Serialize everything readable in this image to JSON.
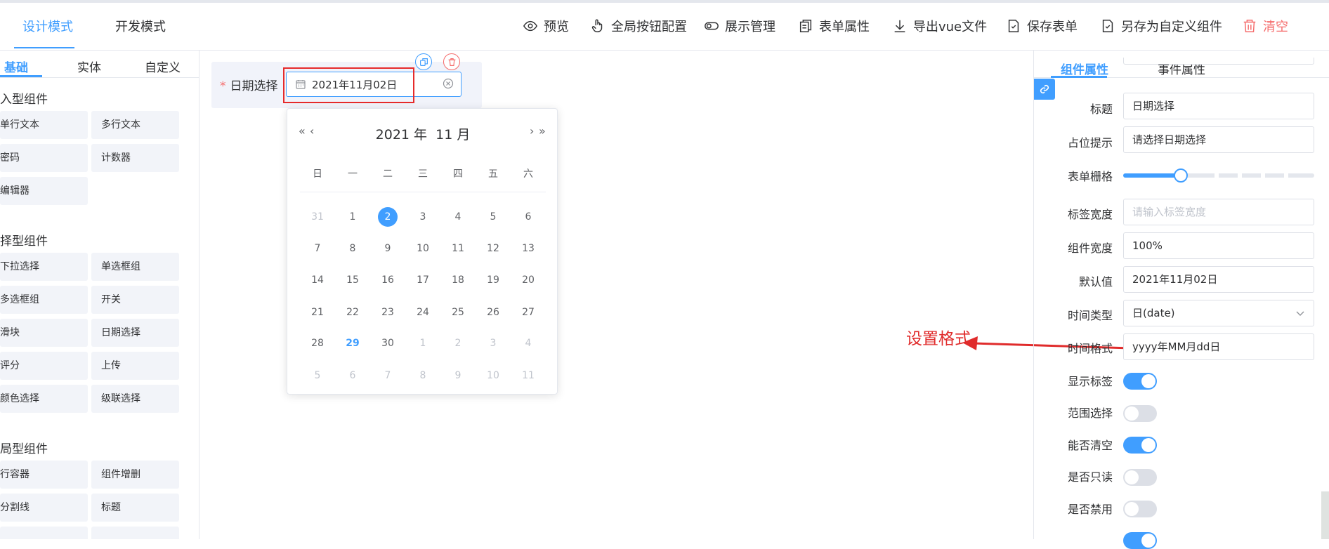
{
  "topbar": {
    "mode_tabs": [
      "设计模式",
      "开发模式"
    ],
    "actions": {
      "preview": "预览",
      "global_buttons": "全局按钮配置",
      "display": "展示管理",
      "form_props": "表单属性",
      "export_vue": "导出vue文件",
      "save_form": "保存表单",
      "save_as_custom": "另存为自定义组件",
      "clear": "清空"
    }
  },
  "left": {
    "tabs": [
      "基础",
      "实体",
      "自定义"
    ],
    "groups": [
      {
        "title": "入型组件",
        "items": [
          "单行文本",
          "多行文本",
          "密码",
          "计数器",
          "编辑器"
        ]
      },
      {
        "title": "择型组件",
        "items": [
          "下拉选择",
          "单选框组",
          "多选框组",
          "开关",
          "滑块",
          "日期选择",
          "评分",
          "上传",
          "颜色选择",
          "级联选择"
        ]
      },
      {
        "title": "局型组件",
        "items": [
          "行容器",
          "组件增删",
          "分割线",
          "标题"
        ]
      }
    ]
  },
  "canvas": {
    "field_label": "日期选择",
    "field_value": "2021年11月02日"
  },
  "picker": {
    "year_label": "2021 年",
    "month_label": "11 月",
    "nav_prev_year": "«",
    "nav_prev_month": "‹",
    "nav_next_month": "›",
    "nav_next_year": "»",
    "weekdays": [
      "日",
      "一",
      "二",
      "三",
      "四",
      "五",
      "六"
    ],
    "days": [
      [
        "31",
        "1",
        "2",
        "3",
        "4",
        "5",
        "6"
      ],
      [
        "7",
        "8",
        "9",
        "10",
        "11",
        "12",
        "13"
      ],
      [
        "14",
        "15",
        "16",
        "17",
        "18",
        "19",
        "20"
      ],
      [
        "21",
        "22",
        "23",
        "24",
        "25",
        "26",
        "27"
      ],
      [
        "28",
        "29",
        "30",
        "1",
        "2",
        "3",
        "4"
      ],
      [
        "5",
        "6",
        "7",
        "8",
        "9",
        "10",
        "11"
      ]
    ],
    "selected_day": "2",
    "today_day": "29"
  },
  "annotation": {
    "text": "设置格式",
    "color": "#e02b2b"
  },
  "right": {
    "tabs": [
      "组件属性",
      "事件属性"
    ],
    "props": {
      "title_label": "标题",
      "title_value": "日期选择",
      "placeholder_label": "占位提示",
      "placeholder_value": "请选择日期选择",
      "grid_label": "表单栅格",
      "grid_fraction": 0.3,
      "label_width_label": "标签宽度",
      "label_width_placeholder": "请输入标签宽度",
      "comp_width_label": "组件宽度",
      "comp_width_value": "100%",
      "default_label": "默认值",
      "default_value": "2021年11月02日",
      "time_type_label": "时间类型",
      "time_type_value": "日(date)",
      "time_format_label": "时间格式",
      "time_format_value": "yyyy年MM月dd日",
      "show_label_label": "显示标签",
      "show_label_on": true,
      "range_label": "范围选择",
      "range_on": false,
      "clearable_label": "能否清空",
      "clearable_on": true,
      "readonly_label": "是否只读",
      "readonly_on": false,
      "disabled_label": "是否禁用",
      "disabled_on": false
    }
  },
  "colors": {
    "accent": "#409eff",
    "danger": "#f56c6c"
  }
}
